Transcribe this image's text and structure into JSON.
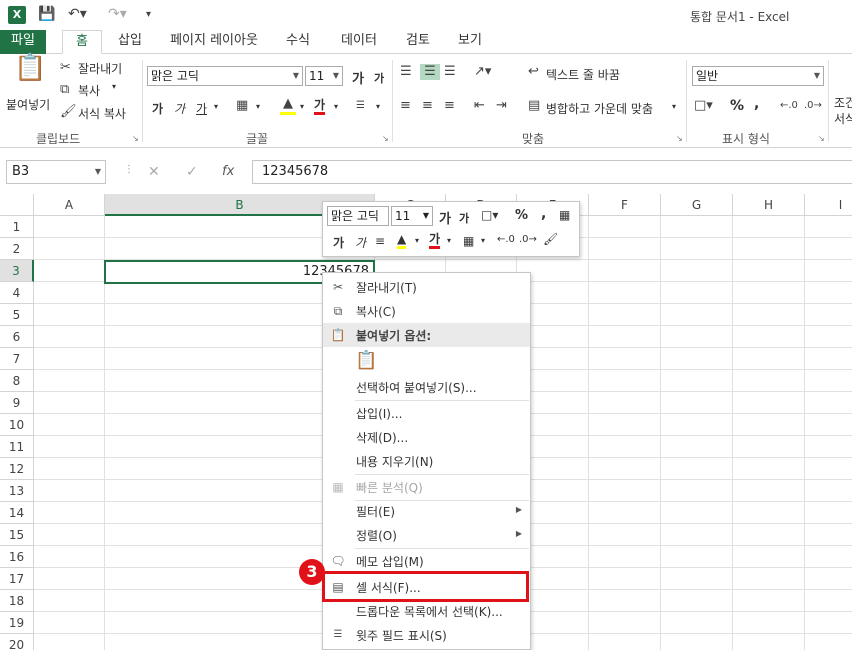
{
  "titlebar": {
    "app_icon": "X",
    "doc_title": "통합 문서1 - Excel"
  },
  "tabs": [
    "파일",
    "홈",
    "삽입",
    "페이지 레이아웃",
    "수식",
    "데이터",
    "검토",
    "보기"
  ],
  "ribbon": {
    "clipboard": {
      "paste": "붙여넣기",
      "cut": "잘라내기",
      "copy": "복사",
      "format_painter": "서식 복사",
      "label": "클립보드"
    },
    "font": {
      "name": "맑은 고딕",
      "size": "11",
      "grow": "가",
      "shrink": "가",
      "bold": "가",
      "italic": "가",
      "underline": "가",
      "color_btn": "가",
      "label": "글꼴"
    },
    "align": {
      "wrap": "텍스트 줄 바꿈",
      "merge": "병합하고 가운데 맞춤",
      "label": "맞춤"
    },
    "number": {
      "format": "일반",
      "percent": "%",
      "comma": ",",
      "label": "표시 형식"
    },
    "cond": "조건",
    "cond2": "서식"
  },
  "formula_bar": {
    "name_box": "B3",
    "cancel": "✕",
    "enter": "✓",
    "fx": "fx",
    "value": "12345678"
  },
  "grid": {
    "columns": [
      "A",
      "B",
      "C",
      "D",
      "E",
      "F",
      "G",
      "H",
      "I"
    ],
    "selected_column": "B",
    "rows": [
      "1",
      "2",
      "3",
      "4",
      "5",
      "6",
      "7",
      "8",
      "9",
      "10",
      "11",
      "12",
      "13",
      "14",
      "15",
      "16",
      "17",
      "18",
      "19",
      "20"
    ],
    "selected_row": "3",
    "active_cell_value": "12345678"
  },
  "mini_toolbar": {
    "font": "맑은 고딕",
    "size": "11",
    "grow": "가",
    "shrink": "가",
    "percent": "%",
    "comma": ",",
    "bold": "가",
    "italic": "가",
    "color": "가"
  },
  "context_menu": {
    "items": [
      {
        "label": "잘라내기(T)",
        "icon": "scissors-icon"
      },
      {
        "label": "복사(C)",
        "icon": "copy-icon"
      },
      {
        "label": "붙여넣기 옵션:",
        "icon": "paste-icon",
        "header": true
      },
      {
        "label": "",
        "icon": "paste-clipboard-icon"
      },
      {
        "label": "선택하여 붙여넣기(S)...",
        "icon": ""
      },
      {
        "label": "삽입(I)...",
        "icon": ""
      },
      {
        "label": "삭제(D)...",
        "icon": ""
      },
      {
        "label": "내용 지우기(N)",
        "icon": ""
      },
      {
        "label": "빠른 분석(Q)",
        "icon": "quick-analysis-icon",
        "disabled": true
      },
      {
        "label": "필터(E)",
        "icon": "",
        "submenu": true
      },
      {
        "label": "정렬(O)",
        "icon": "",
        "submenu": true
      },
      {
        "label": "메모 삽입(M)",
        "icon": "comment-icon"
      },
      {
        "label": "셀 서식(F)...",
        "icon": "format-cells-icon"
      },
      {
        "label": "드롭다운 목록에서 선택(K)...",
        "icon": ""
      },
      {
        "label": "윗주 필드 표시(S)",
        "icon": "phonetic-icon"
      }
    ]
  },
  "annotation": {
    "step": "3",
    "color": "#e1111a"
  },
  "colors": {
    "accent": "#217346",
    "highlight": "#e1111a"
  }
}
